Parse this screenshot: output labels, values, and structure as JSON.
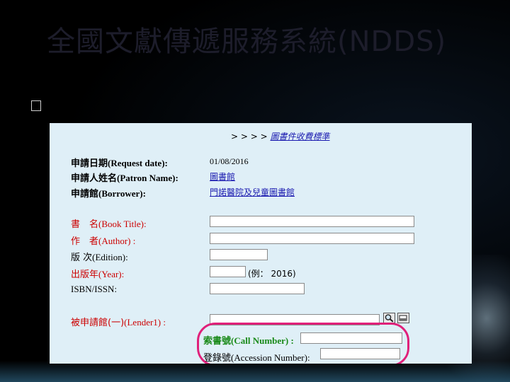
{
  "slide": {
    "title": "全國文獻傳遞服務系統(NDDS)"
  },
  "breadcrumb": {
    "prefix": "> > > >",
    "link": "圖書件收費標準"
  },
  "form": {
    "request_date": {
      "zh": "申請日期",
      "en": "(Request date):",
      "value": "01/08/2016"
    },
    "patron_name": {
      "zh": "申請人姓名",
      "en": "(Patron Name):",
      "value": "圖書館"
    },
    "borrower": {
      "zh": "申請館",
      "en": "(Borrower):",
      "value": "門諾醫院及兒童圖書館"
    },
    "book_title": {
      "zh": "書　名",
      "en": "(Book Title):",
      "value": ""
    },
    "author": {
      "zh": "作　者",
      "en": "(Author) :",
      "value": ""
    },
    "edition": {
      "zh": "版 次",
      "en": "(Edition):",
      "value": ""
    },
    "year": {
      "zh": "出版年",
      "en": "(Year):",
      "value": "",
      "hint": "(例： 2016)"
    },
    "isbn": {
      "label": "ISBN/ISSN:",
      "value": ""
    },
    "lender1": {
      "zh": "被申請館(一)",
      "en": "(Lender1) :",
      "value": ""
    },
    "call_number": {
      "zh": "索書號",
      "en": "(Call Number) :",
      "value": ""
    },
    "accession_number": {
      "zh": "登錄號",
      "en": "(Accession Number):",
      "value": ""
    }
  },
  "colors": {
    "highlight": "#e0207a",
    "link": "#1a1ab0",
    "required_label": "#cc0000",
    "library_fields": "#1a8a1a",
    "panel_bg": "#dfeff7"
  },
  "icons": {
    "bullet": "square-bullet-icon",
    "search": "search-icon",
    "clear": "eraser-icon"
  }
}
